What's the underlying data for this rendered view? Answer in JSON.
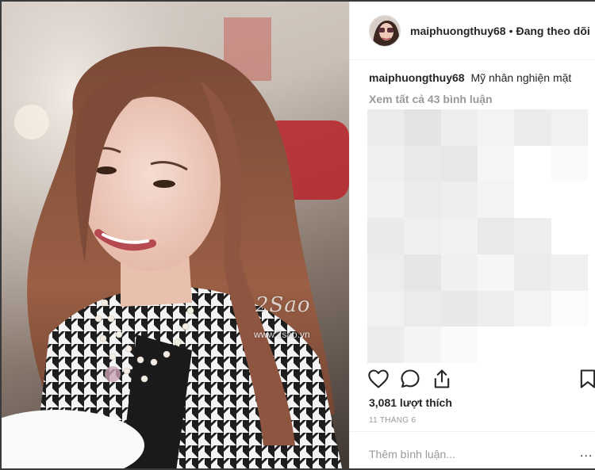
{
  "post": {
    "username": "maiphuongthuy68",
    "separator": "•",
    "follow_status": "Đang theo dõi",
    "caption": "Mỹ nhân nghiện mặt",
    "view_all_comments": "Xem tất cả 43 bình luận",
    "likes": "3,081 lượt thích",
    "date": "11 THÁNG 6",
    "comment_placeholder": "Thêm bình luận...",
    "more_options": "..."
  },
  "watermark": {
    "logo": "2Sao",
    "url": "www.2sao.vn"
  },
  "icons": {
    "like": "heart-icon",
    "comment": "comment-icon",
    "share": "share-icon",
    "save": "bookmark-icon"
  }
}
